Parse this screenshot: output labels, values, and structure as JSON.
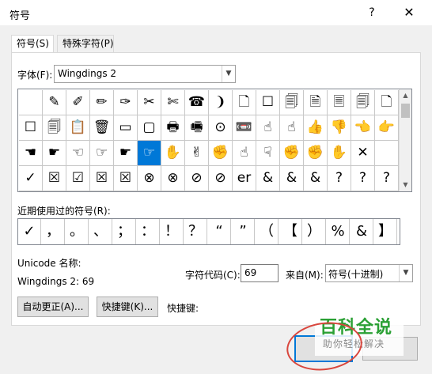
{
  "window": {
    "title": "符号",
    "help": "?",
    "close": "✕"
  },
  "tabs": [
    {
      "label": "符号(S)",
      "active": true
    },
    {
      "label": "特殊字符(P)",
      "active": false
    }
  ],
  "font": {
    "label": "字体(F):",
    "value": "Wingdings 2"
  },
  "symbol_grid": {
    "rows": [
      [
        "",
        "✎",
        "✐",
        "✏",
        "✑",
        "✂",
        "✄",
        "☎",
        "❩",
        "🗋",
        "☐",
        "🗐",
        "🗎",
        "🗏",
        "🗐",
        "🗋"
      ],
      [
        "☐",
        "🗐",
        "📋",
        "🗑",
        "▭",
        "▢",
        "🖶",
        "🖷",
        "⊙",
        "📼",
        "☝",
        "☝",
        "👍",
        "👎",
        "👈",
        "👉"
      ],
      [
        "☚",
        "☛",
        "☜",
        "☞",
        "☛",
        "☞",
        "✋",
        "✌",
        "✊",
        "☝",
        "☟",
        "✊",
        "✊",
        "✋",
        "✕",
        ""
      ],
      [
        "✓",
        "☒",
        "☑",
        "☒",
        "☒",
        "⊗",
        "⊗",
        "⊘",
        "⊘",
        "er",
        "&",
        "&",
        "&",
        "?",
        "?",
        "?"
      ]
    ],
    "selected": {
      "row": 2,
      "col": 5
    },
    "scroll_up": "▲",
    "scroll_down": "▼"
  },
  "recent": {
    "label": "近期使用过的符号(R):",
    "symbols": [
      "✓",
      "，",
      "。",
      "、",
      "；",
      "：",
      "！",
      "？",
      "“",
      "”",
      "（",
      "【",
      "）",
      "%",
      "&",
      "】"
    ]
  },
  "unicode": {
    "label": "Unicode 名称:",
    "value": "Wingdings 2: 69"
  },
  "char_code": {
    "label": "字符代码(C):",
    "value": "69"
  },
  "from": {
    "label": "来自(M):",
    "value": "符号(十进制)"
  },
  "buttons": {
    "autocorrect": "自动更正(A)...",
    "shortcut_key": "快捷键(K)...",
    "shortcut_label": "快捷键:"
  },
  "watermark": {
    "title": "百科全说",
    "subtitle": "助你轻松解决"
  },
  "colors": {
    "selection": "#0078d7",
    "watermark_green": "#2aa034",
    "highlight_red": "#d9463d"
  }
}
